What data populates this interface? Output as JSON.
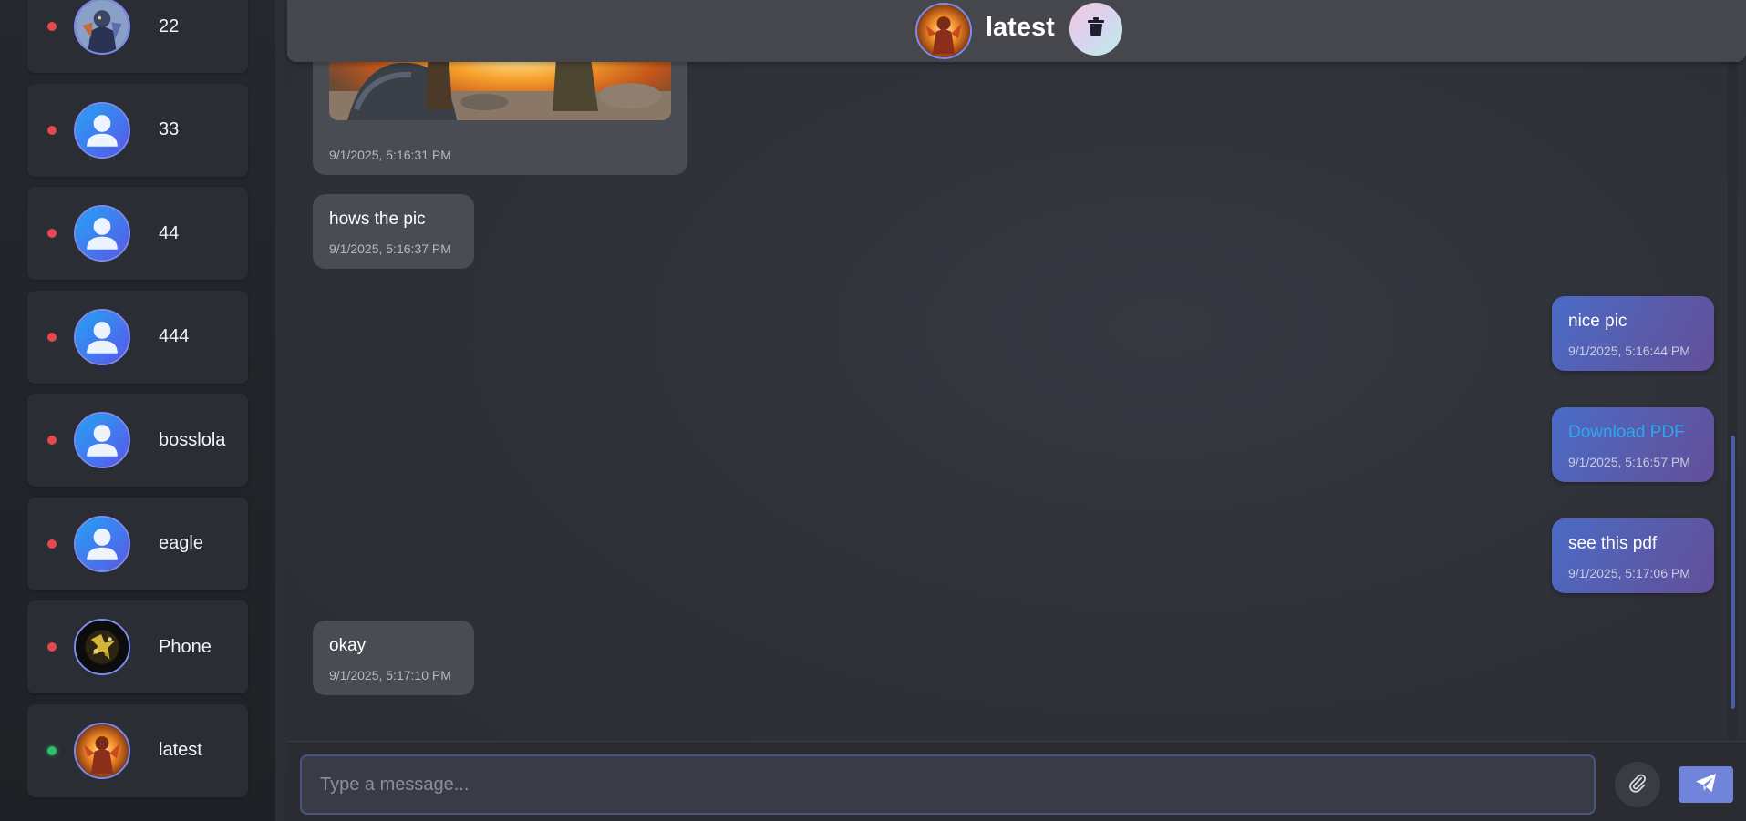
{
  "sidebar": {
    "contacts": [
      {
        "name": "22",
        "status": "offline",
        "avatar": "fantasy-warrior-avatar"
      },
      {
        "name": "33",
        "status": "offline",
        "avatar": "default-user-icon"
      },
      {
        "name": "44",
        "status": "offline",
        "avatar": "default-user-icon"
      },
      {
        "name": "444",
        "status": "offline",
        "avatar": "default-user-icon"
      },
      {
        "name": "bosslola",
        "status": "offline",
        "avatar": "default-user-icon"
      },
      {
        "name": "eagle",
        "status": "offline",
        "avatar": "default-user-icon"
      },
      {
        "name": "Phone",
        "status": "offline",
        "avatar": "gold-pattern-avatar"
      },
      {
        "name": "latest",
        "status": "online",
        "avatar": "fire-warrior-avatar"
      }
    ]
  },
  "header": {
    "title": "latest",
    "avatar": "fire-warrior-avatar",
    "delete_icon": "trash-icon"
  },
  "messages": [
    {
      "direction": "in",
      "type": "image",
      "image": "explosion-image",
      "time": "9/1/2025, 5:16:31 PM"
    },
    {
      "direction": "in",
      "type": "text",
      "text": "hows the pic",
      "time": "9/1/2025, 5:16:37 PM"
    },
    {
      "direction": "out",
      "type": "text",
      "text": "nice pic",
      "time": "9/1/2025, 5:16:44 PM"
    },
    {
      "direction": "out",
      "type": "link",
      "text": "Download PDF",
      "time": "9/1/2025, 5:16:57 PM"
    },
    {
      "direction": "out",
      "type": "text",
      "text": "see this pdf",
      "time": "9/1/2025, 5:17:06 PM"
    },
    {
      "direction": "in",
      "type": "text",
      "text": "okay",
      "time": "9/1/2025, 5:17:10 PM"
    }
  ],
  "composer": {
    "placeholder": "Type a message...",
    "value": "",
    "attach_icon": "paperclip-icon",
    "send_icon": "paper-plane-icon"
  },
  "colors": {
    "status_offline": "#e5484d",
    "status_online": "#2fbf71",
    "accent": "#6f84da",
    "outgoing_bubble": "#4a6bc7",
    "incoming_bubble": "#4a4c54",
    "link": "#2ea7ee"
  }
}
